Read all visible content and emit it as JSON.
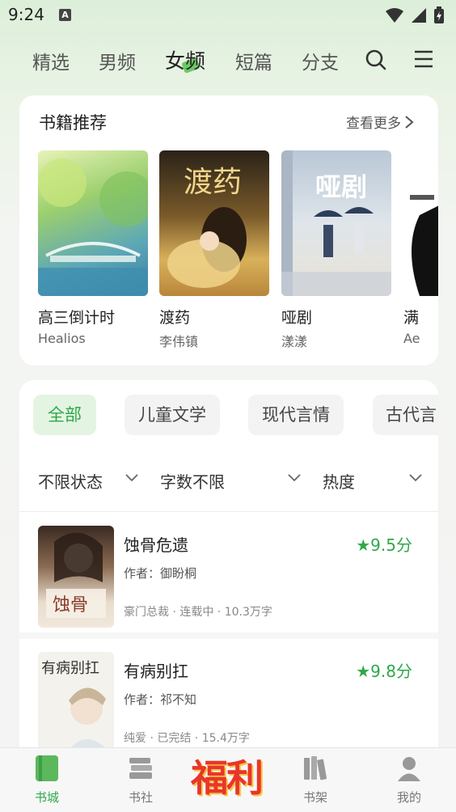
{
  "status_bar": {
    "time": "9:24",
    "notification_glyph": "A"
  },
  "top_nav": {
    "tabs": [
      {
        "label": "精选",
        "active": false
      },
      {
        "label": "男频",
        "active": false
      },
      {
        "label": "女频",
        "active": true
      },
      {
        "label": "短篇",
        "active": false
      },
      {
        "label": "分支",
        "active": false
      }
    ],
    "icons": [
      "search-icon",
      "menu-icon"
    ]
  },
  "recommend": {
    "title": "书籍推荐",
    "more_label": "查看更多",
    "books": [
      {
        "title": "高三倒计时",
        "author": "Healios",
        "cover_text": ""
      },
      {
        "title": "渡药",
        "author": "李伟镇",
        "cover_text": "渡药"
      },
      {
        "title": "哑剧",
        "author": "漾漾",
        "cover_text": "哑剧"
      },
      {
        "title": "满",
        "author": "Ae",
        "cover_text": ""
      }
    ]
  },
  "categories": {
    "chips": [
      {
        "label": "全部",
        "active": true
      },
      {
        "label": "儿童文学",
        "active": false
      },
      {
        "label": "现代言情",
        "active": false
      },
      {
        "label": "古代言",
        "active": false
      }
    ],
    "filters": [
      "不限状态",
      "字数不限",
      "热度"
    ]
  },
  "list": [
    {
      "title": "蚀骨危遗",
      "score": "★9.5分",
      "author": "作者：御盼桐",
      "meta": "豪门总裁 · 连载中 · 10.3万字"
    },
    {
      "title": "有病别扛",
      "score": "★9.8分",
      "author": "作者：祁不知",
      "meta": "纯爱 · 已完结 · 15.4万字"
    }
  ],
  "bottom_bar": {
    "items": [
      {
        "label": "书城",
        "icon": "book-icon",
        "active": true
      },
      {
        "label": "书社",
        "icon": "books-stack-icon",
        "active": false
      },
      {
        "label": "福利",
        "icon": "welfare-logo",
        "active": false
      },
      {
        "label": "书架",
        "icon": "bookshelf-icon",
        "active": false
      },
      {
        "label": "我的",
        "icon": "user-icon",
        "active": false
      }
    ]
  },
  "colors": {
    "accent": "#2ea84a",
    "welfare_red": "#e8362a"
  }
}
